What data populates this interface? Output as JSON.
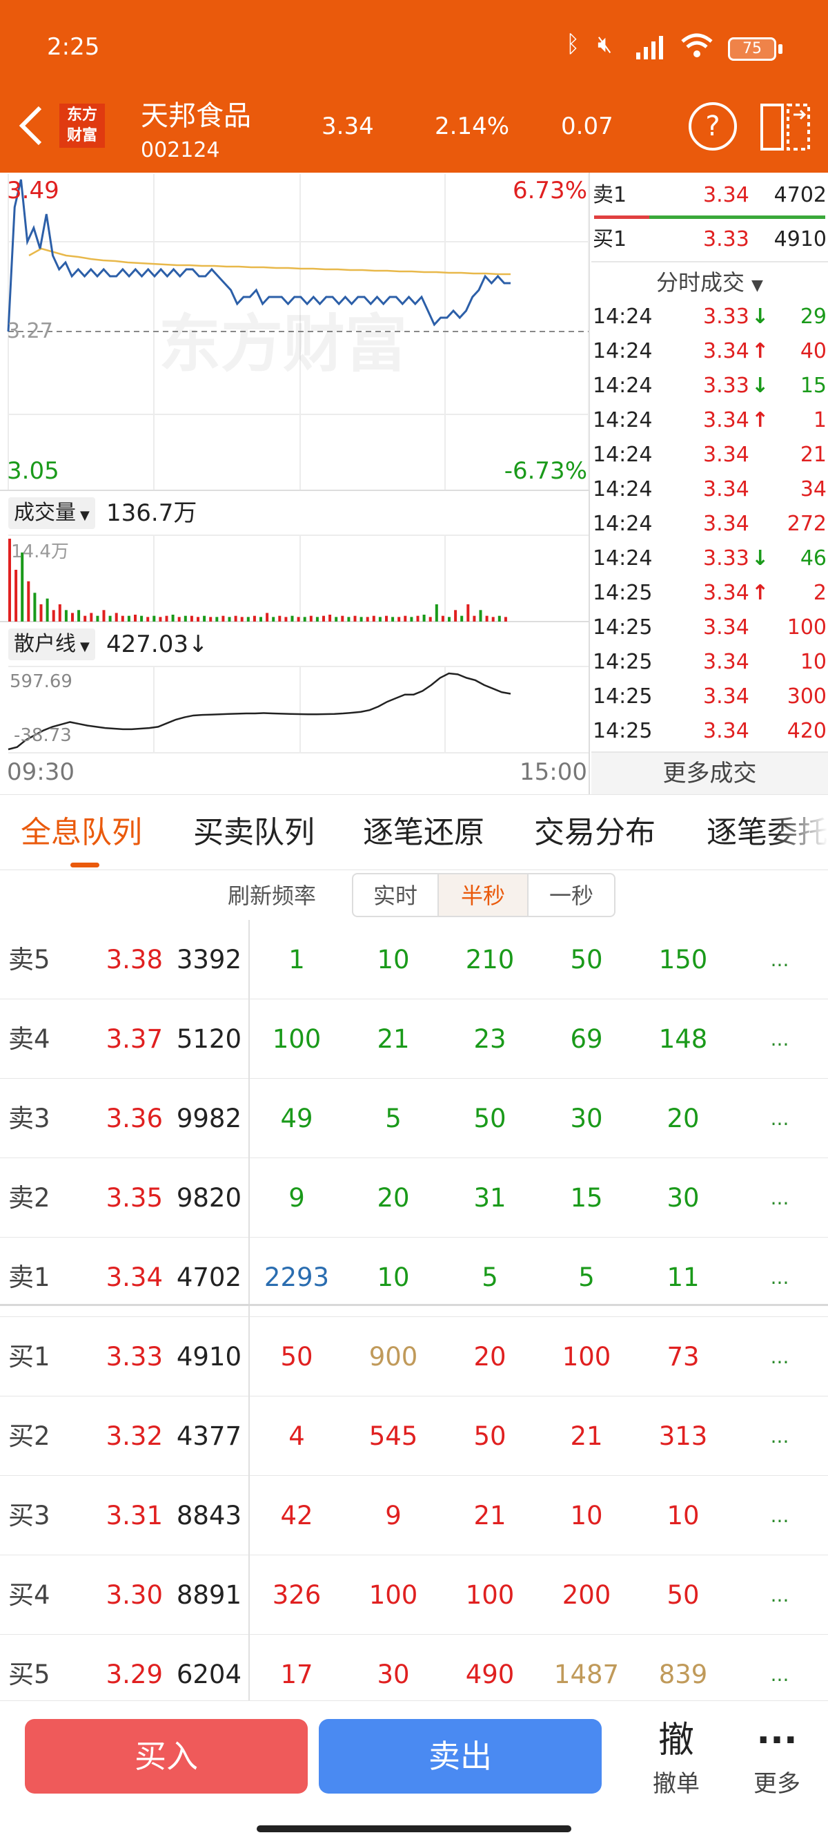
{
  "status_bar": {
    "time": "2:25",
    "battery": "75"
  },
  "header": {
    "logo_line1": "东方",
    "logo_line2": "财富",
    "stock_name": "天邦食品",
    "stock_code": "002124",
    "price": "3.34",
    "change_pct": "2.14%",
    "change": "0.07",
    "help_glyph": "?"
  },
  "chart": {
    "y_top": "3.49",
    "pct_top": "6.73%",
    "y_mid": "3.27",
    "y_bottom": "3.05",
    "pct_bottom": "-6.73%",
    "watermark": "东方财富",
    "volume_selector": "成交量",
    "volume_total": "136.7万",
    "volume_max_label": "14.4万",
    "indicator_selector": "散户线",
    "indicator_value": "427.03",
    "indicator_arrow": "↓",
    "indicator_max": "597.69",
    "indicator_min": "-38.73",
    "time_start": "09:30",
    "time_end": "15:00"
  },
  "chart_data": {
    "type": "line",
    "ylim": [
      3.05,
      3.49
    ],
    "base_price": 3.27,
    "price_series": [
      3.27,
      3.45,
      3.49,
      3.4,
      3.42,
      3.39,
      3.44,
      3.38,
      3.36,
      3.37,
      3.35,
      3.36,
      3.35,
      3.36,
      3.35,
      3.36,
      3.35,
      3.35,
      3.36,
      3.35,
      3.36,
      3.35,
      3.36,
      3.35,
      3.36,
      3.35,
      3.36,
      3.35,
      3.36,
      3.36,
      3.35,
      3.35,
      3.36,
      3.35,
      3.34,
      3.33,
      3.31,
      3.32,
      3.32,
      3.33,
      3.31,
      3.32,
      3.32,
      3.32,
      3.31,
      3.32,
      3.32,
      3.31,
      3.32,
      3.31,
      3.32,
      3.32,
      3.31,
      3.32,
      3.31,
      3.32,
      3.32,
      3.31,
      3.32,
      3.31,
      3.32,
      3.32,
      3.31,
      3.32,
      3.31,
      3.32,
      3.3,
      3.28,
      3.29,
      3.29,
      3.3,
      3.29,
      3.3,
      3.32,
      3.33,
      3.35,
      3.34,
      3.35,
      3.34,
      3.34
    ],
    "avg_series": [
      3.38,
      3.39,
      3.385,
      3.38,
      3.378,
      3.375,
      3.373,
      3.372,
      3.37,
      3.369,
      3.368,
      3.367,
      3.366,
      3.366,
      3.365,
      3.365,
      3.364,
      3.364,
      3.363,
      3.363,
      3.362,
      3.362,
      3.361,
      3.361,
      3.36,
      3.36,
      3.359,
      3.359,
      3.358,
      3.358,
      3.357,
      3.357,
      3.356,
      3.356,
      3.355,
      3.355,
      3.354,
      3.354,
      3.353,
      3.353
    ],
    "volume_series": [
      14.4,
      9,
      12,
      7,
      5,
      3,
      4,
      2,
      3,
      2,
      1.5,
      2,
      1,
      1.5,
      1,
      2,
      1,
      1.5,
      1,
      1,
      1.2,
      1,
      0.8,
      1,
      0.8,
      1,
      1.2,
      0.8,
      1,
      1,
      0.8,
      1,
      0.8,
      0.8,
      1,
      0.8,
      1,
      0.8,
      0.8,
      1,
      0.8,
      1.5,
      0.8,
      1,
      0.8,
      1,
      0.8,
      0.8,
      1,
      0.8,
      1,
      1.2,
      0.8,
      1,
      0.8,
      1,
      0.8,
      0.8,
      1,
      0.8,
      1,
      0.8,
      0.8,
      1,
      0.8,
      1,
      1.2,
      0.8,
      3,
      1,
      0.8,
      2,
      1,
      3,
      1,
      2,
      1,
      0.8,
      1,
      0.8
    ],
    "volume_colors": [
      "r",
      "r",
      "g",
      "r",
      "g",
      "r",
      "g",
      "r",
      "r",
      "g",
      "r",
      "g",
      "r",
      "r",
      "g",
      "r",
      "g",
      "r",
      "r",
      "g",
      "r",
      "g",
      "r",
      "g",
      "r",
      "r",
      "g",
      "r",
      "g",
      "r",
      "r",
      "g",
      "r",
      "g",
      "r",
      "g",
      "r",
      "r",
      "g",
      "r",
      "g",
      "r",
      "g",
      "r",
      "r",
      "g",
      "r",
      "g",
      "r",
      "g",
      "r",
      "r",
      "g",
      "r",
      "g",
      "r",
      "g",
      "r",
      "r",
      "g",
      "r",
      "g",
      "r",
      "r",
      "g",
      "r",
      "g",
      "r",
      "g",
      "r",
      "g",
      "r",
      "g",
      "r",
      "r",
      "g",
      "r",
      "r",
      "g",
      "r"
    ],
    "indicator_series": [
      -38.73,
      -20,
      40,
      80,
      120,
      150,
      170,
      190,
      175,
      160,
      150,
      140,
      135,
      130,
      130,
      135,
      140,
      150,
      180,
      210,
      230,
      245,
      250,
      252,
      255,
      258,
      260,
      262,
      262,
      265,
      262,
      260,
      258,
      256,
      255,
      255,
      256,
      258,
      262,
      268,
      275,
      290,
      320,
      360,
      390,
      420,
      420,
      450,
      500,
      560,
      597.69,
      590,
      560,
      540,
      500,
      470,
      440,
      427.03
    ],
    "indicator_ylim": [
      -38.73,
      597.69
    ]
  },
  "order_book": [
    {
      "side": "卖1",
      "price": "3.34",
      "vol": "4702"
    },
    {
      "side": "买1",
      "price": "3.33",
      "vol": "4910"
    }
  ],
  "ticks_header": "分时成交",
  "ticks": [
    {
      "t": "14:24",
      "p": "3.33",
      "a": "↓",
      "v": "29",
      "c": "green"
    },
    {
      "t": "14:24",
      "p": "3.34",
      "a": "↑",
      "v": "40",
      "c": "red"
    },
    {
      "t": "14:24",
      "p": "3.33",
      "a": "↓",
      "v": "15",
      "c": "green"
    },
    {
      "t": "14:24",
      "p": "3.34",
      "a": "↑",
      "v": "1",
      "c": "red"
    },
    {
      "t": "14:24",
      "p": "3.34",
      "a": "",
      "v": "21",
      "c": "red"
    },
    {
      "t": "14:24",
      "p": "3.34",
      "a": "",
      "v": "34",
      "c": "red"
    },
    {
      "t": "14:24",
      "p": "3.34",
      "a": "",
      "v": "272",
      "c": "red"
    },
    {
      "t": "14:24",
      "p": "3.33",
      "a": "↓",
      "v": "46",
      "c": "green"
    },
    {
      "t": "14:25",
      "p": "3.34",
      "a": "↑",
      "v": "2",
      "c": "red"
    },
    {
      "t": "14:25",
      "p": "3.34",
      "a": "",
      "v": "100",
      "c": "red"
    },
    {
      "t": "14:25",
      "p": "3.34",
      "a": "",
      "v": "10",
      "c": "red"
    },
    {
      "t": "14:25",
      "p": "3.34",
      "a": "",
      "v": "300",
      "c": "red"
    },
    {
      "t": "14:25",
      "p": "3.34",
      "a": "",
      "v": "420",
      "c": "red"
    }
  ],
  "more_ticks": "更多成交",
  "tabs": [
    "全息队列",
    "买卖队列",
    "逐笔还原",
    "交易分布",
    "逐笔委托"
  ],
  "refresh": {
    "label": "刷新频率",
    "options": [
      "实时",
      "半秒",
      "一秒"
    ],
    "selected": 1
  },
  "queue": [
    {
      "side": "卖5",
      "price": "3.38",
      "vol": "3392",
      "items": [
        {
          "v": "1",
          "c": "green"
        },
        {
          "v": "10",
          "c": "green"
        },
        {
          "v": "210",
          "c": "green"
        },
        {
          "v": "50",
          "c": "green"
        },
        {
          "v": "150",
          "c": "green"
        }
      ]
    },
    {
      "side": "卖4",
      "price": "3.37",
      "vol": "5120",
      "items": [
        {
          "v": "100",
          "c": "green"
        },
        {
          "v": "21",
          "c": "green"
        },
        {
          "v": "23",
          "c": "green"
        },
        {
          "v": "69",
          "c": "green"
        },
        {
          "v": "148",
          "c": "green"
        }
      ]
    },
    {
      "side": "卖3",
      "price": "3.36",
      "vol": "9982",
      "items": [
        {
          "v": "49",
          "c": "green"
        },
        {
          "v": "5",
          "c": "green"
        },
        {
          "v": "50",
          "c": "green"
        },
        {
          "v": "30",
          "c": "green"
        },
        {
          "v": "20",
          "c": "green"
        }
      ]
    },
    {
      "side": "卖2",
      "price": "3.35",
      "vol": "9820",
      "items": [
        {
          "v": "9",
          "c": "green"
        },
        {
          "v": "20",
          "c": "green"
        },
        {
          "v": "31",
          "c": "green"
        },
        {
          "v": "15",
          "c": "green"
        },
        {
          "v": "30",
          "c": "green"
        }
      ]
    },
    {
      "side": "卖1",
      "price": "3.34",
      "vol": "4702",
      "items": [
        {
          "v": "2293",
          "c": "blue"
        },
        {
          "v": "10",
          "c": "green"
        },
        {
          "v": "5",
          "c": "green"
        },
        {
          "v": "5",
          "c": "green"
        },
        {
          "v": "11",
          "c": "green"
        }
      ]
    },
    {
      "side": "买1",
      "price": "3.33",
      "vol": "4910",
      "items": [
        {
          "v": "50",
          "c": "red"
        },
        {
          "v": "900",
          "c": "gold"
        },
        {
          "v": "20",
          "c": "red"
        },
        {
          "v": "100",
          "c": "red"
        },
        {
          "v": "73",
          "c": "red"
        }
      ]
    },
    {
      "side": "买2",
      "price": "3.32",
      "vol": "4377",
      "items": [
        {
          "v": "4",
          "c": "red"
        },
        {
          "v": "545",
          "c": "red"
        },
        {
          "v": "50",
          "c": "red"
        },
        {
          "v": "21",
          "c": "red"
        },
        {
          "v": "313",
          "c": "red"
        }
      ]
    },
    {
      "side": "买3",
      "price": "3.31",
      "vol": "8843",
      "items": [
        {
          "v": "42",
          "c": "red"
        },
        {
          "v": "9",
          "c": "red"
        },
        {
          "v": "21",
          "c": "red"
        },
        {
          "v": "10",
          "c": "red"
        },
        {
          "v": "10",
          "c": "red"
        }
      ]
    },
    {
      "side": "买4",
      "price": "3.30",
      "vol": "8891",
      "items": [
        {
          "v": "326",
          "c": "red"
        },
        {
          "v": "100",
          "c": "red"
        },
        {
          "v": "100",
          "c": "red"
        },
        {
          "v": "200",
          "c": "red"
        },
        {
          "v": "50",
          "c": "red"
        }
      ]
    },
    {
      "side": "买5",
      "price": "3.29",
      "vol": "6204",
      "items": [
        {
          "v": "17",
          "c": "red"
        },
        {
          "v": "30",
          "c": "red"
        },
        {
          "v": "490",
          "c": "red"
        },
        {
          "v": "1487",
          "c": "gold"
        },
        {
          "v": "839",
          "c": "gold"
        }
      ]
    }
  ],
  "ellipsis": "...",
  "bottom": {
    "buy": "买入",
    "sell": "卖出",
    "cancel_glyph": "撤",
    "cancel": "撤单",
    "more": "更多"
  },
  "colors": {
    "header": "#ea5a0c",
    "red": "#e02020",
    "green": "#1a9a1a",
    "buy_btn": "#ef5a5a",
    "sell_btn": "#4a8af2"
  }
}
